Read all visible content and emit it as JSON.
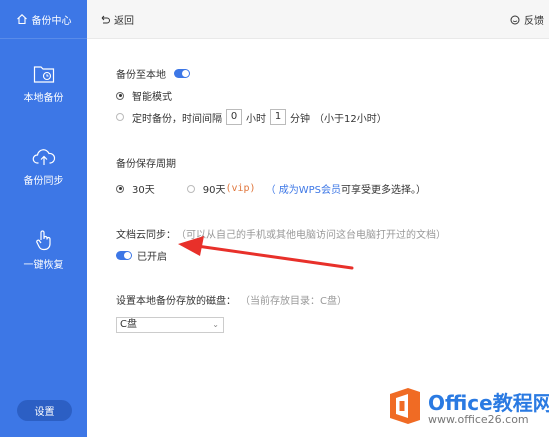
{
  "sidebar": {
    "header_label": "备份中心",
    "items": [
      {
        "label": "本地备份"
      },
      {
        "label": "备份同步"
      },
      {
        "label": "一键恢复"
      }
    ],
    "settings_label": "设置"
  },
  "topbar": {
    "back_label": "返回",
    "feedback_label": "反馈"
  },
  "backup_local": {
    "title": "备份至本地",
    "enabled": true,
    "smart_mode_label": "智能模式",
    "timed_label_prefix": "定时备份，时间间隔",
    "hours_value": "0",
    "hours_unit": "小时",
    "minutes_value": "1",
    "minutes_unit": "分钟",
    "note": "（小于12小时）"
  },
  "retention": {
    "title": "备份保存周期",
    "opt30": "30天",
    "opt90": "90天",
    "vip_tag": "(vip)",
    "member_link": "（ 成为WPS会员",
    "member_suffix": " 可享受更多选择。）"
  },
  "cloud_sync": {
    "title": "文档云同步：",
    "description": "（可以从自己的手机或其他电脑访问这台电脑打开过的文档）",
    "status": "已开启"
  },
  "disk": {
    "title": "设置本地备份存放的磁盘：",
    "current": "（当前存放目录：C盘）",
    "selected": "C盘"
  },
  "watermark": {
    "title": "Office教程网",
    "url": "www.office26.com"
  },
  "colors": {
    "sidebar": "#3d77e6",
    "accent": "#3d77e6",
    "arrow": "#e8302a",
    "logo_orange": "#f06b24"
  }
}
